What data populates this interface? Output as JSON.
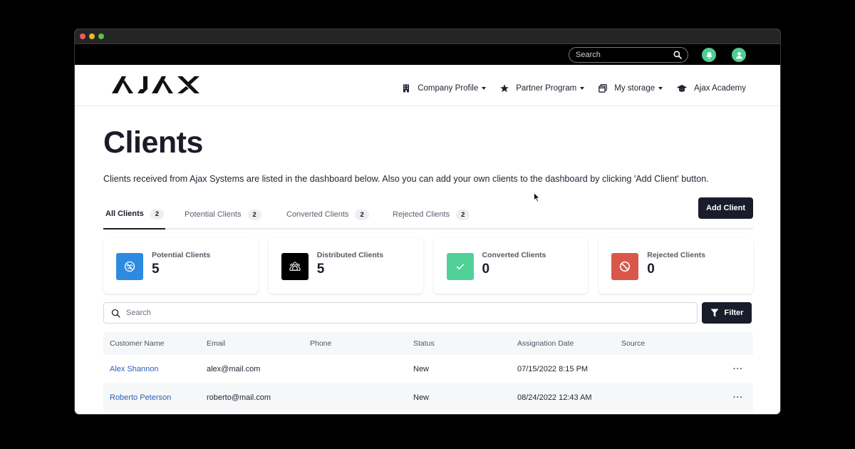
{
  "window": {
    "traffic_lights": [
      "close",
      "minimize",
      "maximize"
    ]
  },
  "topbar": {
    "search_placeholder": "Search",
    "icons": [
      "search-icon",
      "bell-icon",
      "user-icon"
    ],
    "accent_color": "#4fce91"
  },
  "navbar": {
    "logo_text": "AJAX",
    "items": [
      {
        "label": "Company Profile",
        "icon": "building-icon",
        "dropdown": true
      },
      {
        "label": "Partner Program",
        "icon": "star-icon",
        "dropdown": true
      },
      {
        "label": "My storage",
        "icon": "storage-icon",
        "dropdown": true
      },
      {
        "label": "Ajax Academy",
        "icon": "graduation-cap-icon",
        "dropdown": false
      }
    ]
  },
  "page": {
    "title": "Clients",
    "description": "Clients received from Ajax Systems are listed in the dashboard below. Also you can add your own clients to the dashboard by clicking 'Add Client' button."
  },
  "tabs": [
    {
      "label": "All Clients",
      "count": "2",
      "active": true
    },
    {
      "label": "Potential Clients",
      "count": "2",
      "active": false
    },
    {
      "label": "Converted Clients",
      "count": "2",
      "active": false
    },
    {
      "label": "Rejected Clients",
      "count": "2",
      "active": false
    }
  ],
  "add_client_label": "Add Client",
  "stats": [
    {
      "label": "Potential Clients",
      "value": "5",
      "icon": "handshake-icon",
      "color": "#2c8be0"
    },
    {
      "label": "Distributed Clients",
      "value": "5",
      "icon": "group-icon",
      "color": "#000000"
    },
    {
      "label": "Converted Clients",
      "value": "0",
      "icon": "check-icon",
      "color": "#4fd198"
    },
    {
      "label": "Rejected Clients",
      "value": "0",
      "icon": "block-icon",
      "color": "#d9574a"
    }
  ],
  "search": {
    "placeholder": "Search",
    "filter_label": "Filter"
  },
  "table": {
    "columns": [
      "Customer Name",
      "Email",
      "Phone",
      "Status",
      "Assignation Date",
      "Source"
    ],
    "rows": [
      {
        "name": "Alex Shannon",
        "email": "alex@mail.com",
        "phone": "",
        "status": "New",
        "date": "07/15/2022 8:15 PM",
        "source": "",
        "actions": "···"
      },
      {
        "name": "Roberto Peterson",
        "email": "roberto@mail.com",
        "phone": "",
        "status": "New",
        "date": "08/24/2022 12:43 AM",
        "source": "",
        "actions": "···"
      }
    ]
  }
}
